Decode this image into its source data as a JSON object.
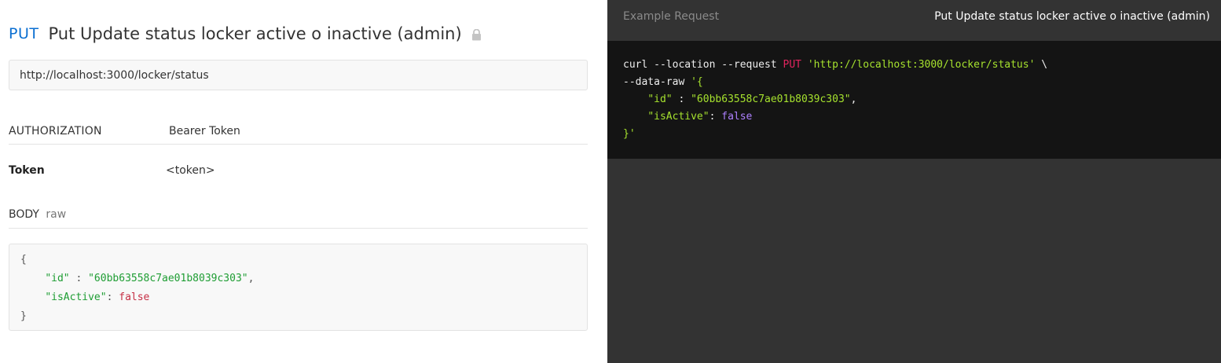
{
  "request": {
    "method": "PUT",
    "title": "Put Update status locker active o inactive (admin)",
    "url": "http://localhost:3000/locker/status"
  },
  "authorization": {
    "label": "AUTHORIZATION",
    "type": "Bearer Token",
    "token_key": "Token",
    "token_value": "<token>"
  },
  "body": {
    "label": "BODY",
    "mode": "raw",
    "code": {
      "open": "{",
      "id_key": "\"id\"",
      "id_sep": " : ",
      "id_value": "\"60bb63558c7ae01b8039c303\"",
      "id_comma": ",",
      "active_key": "\"isActive\"",
      "active_sep": ": ",
      "active_value": "false",
      "close": "}"
    }
  },
  "example": {
    "label": "Example Request",
    "title": "Put Update status locker active o inactive (admin)",
    "curl": {
      "l1_a": "curl --location --request ",
      "l1_method": "PUT",
      "l1_space": " ",
      "l1_url": "'http://localhost:3000/locker/status'",
      "l1_end": " \\",
      "l2_a": "--data-raw ",
      "l2_b": "'{",
      "l3_indent": "    ",
      "l3_key": "\"id\"",
      "l3_sep": " : ",
      "l3_val": "\"60bb63558c7ae01b8039c303\"",
      "l3_comma": ",",
      "l4_indent": "    ",
      "l4_key": "\"isActive\"",
      "l4_sep": ": ",
      "l4_val": "false",
      "l5": "}'"
    }
  },
  "colors": {
    "method_blue": "#0b6fd1",
    "dark_panel": "#333333",
    "code_bg": "#141414",
    "string_green": "#1e9d33",
    "keyword_red": "#c62f45"
  },
  "icons": {
    "lock": "lock-icon"
  }
}
